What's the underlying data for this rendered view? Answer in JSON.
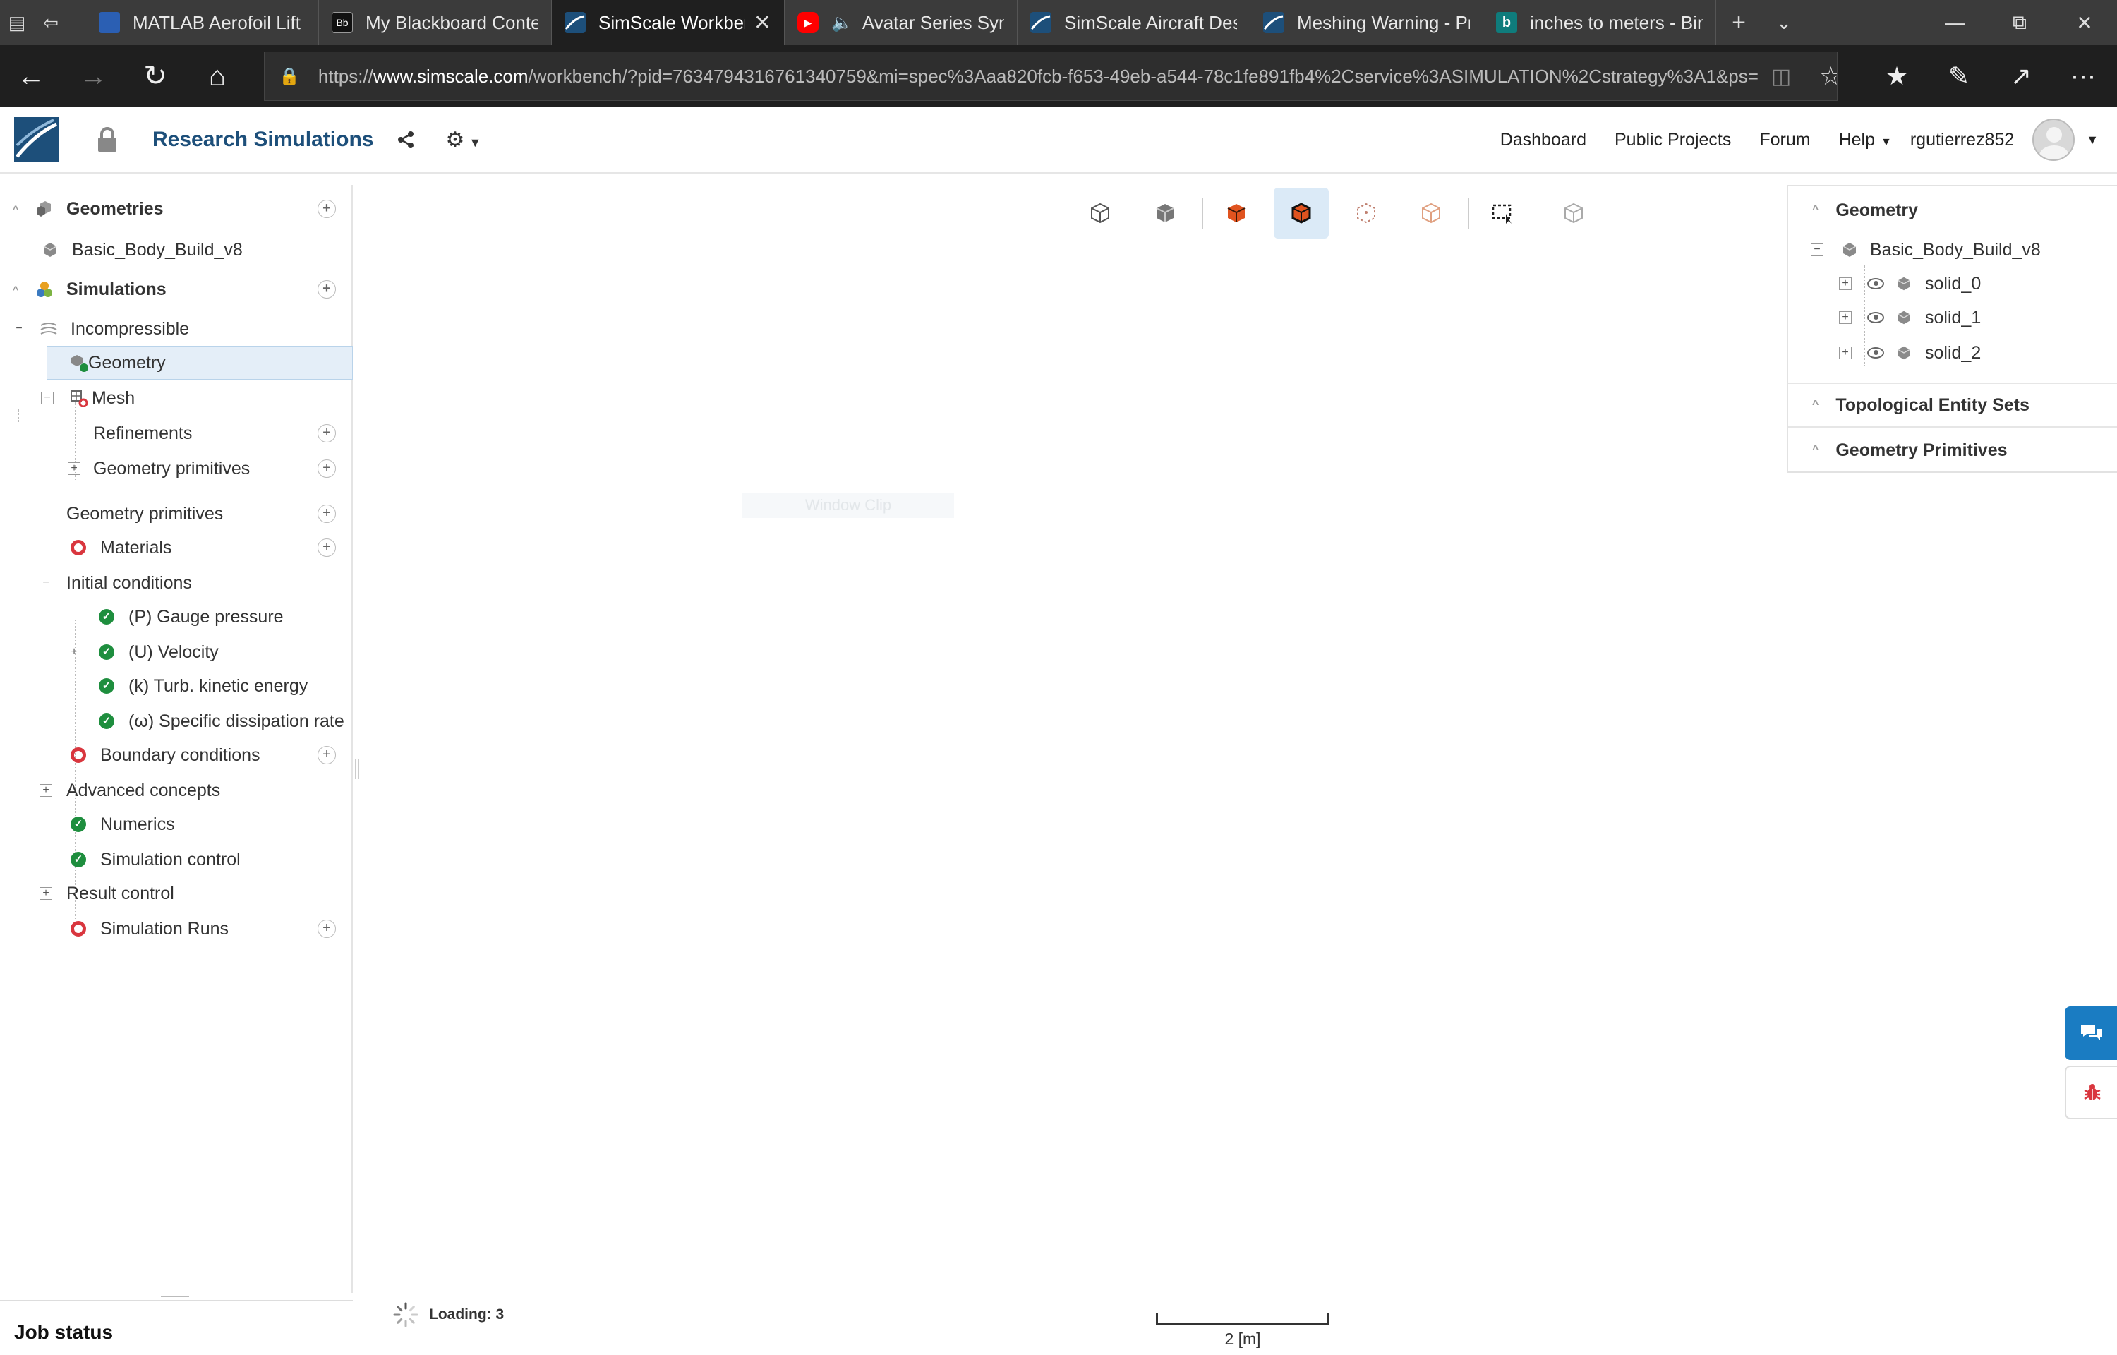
{
  "browser": {
    "tabs": [
      {
        "title": "MATLAB Aerofoil Lift C",
        "fav_color": "#2b5fb3",
        "icon": "matlab-tab-favicon"
      },
      {
        "title": "My Blackboard Conter",
        "fav_color": "#111111",
        "icon": "blackboard-tab-favicon"
      },
      {
        "title": "SimScale Workber",
        "fav_color": "#1d4f7a",
        "icon": "simscale-tab-favicon",
        "active": true
      },
      {
        "title": "Avatar Series Sym",
        "fav_color": "#ff0000",
        "icon": "youtube-tab-favicon"
      },
      {
        "title": "SimScale Aircraft Desi",
        "fav_color": "#1d4f7a",
        "icon": "simscale-tab-favicon"
      },
      {
        "title": "Meshing Warning - Pr",
        "fav_color": "#1d4f7a",
        "icon": "simscale-tab-favicon"
      },
      {
        "title": "inches to meters - Bin",
        "fav_color": "#0f7c7c",
        "icon": "bing-tab-favicon"
      }
    ],
    "url_prefix": "https://",
    "url_host": "www.simscale.com",
    "url_tail": "/workbench/?pid=7634794316761340759&mi=spec%3Aaa820fcb-f653-49eb-a544-78c1fe891fb4%2Cservice%3ASIMULATION%2Cstrategy%3A1&ps="
  },
  "header": {
    "project_title": "Research Simulations",
    "nav": {
      "dashboard": "Dashboard",
      "public_projects": "Public Projects",
      "forum": "Forum",
      "help": "Help",
      "username": "rgutierrez852"
    }
  },
  "tree": {
    "geometries": "Geometries",
    "geometry_item": "Basic_Body_Build_v8",
    "simulations": "Simulations",
    "incompressible": "Incompressible",
    "geometry": "Geometry",
    "mesh": "Mesh",
    "refinements": "Refinements",
    "mesh_geometry_primitives": "Geometry primitives",
    "geometry_primitives": "Geometry primitives",
    "materials": "Materials",
    "initial_conditions": "Initial conditions",
    "ic_pressure": "(P) Gauge pressure",
    "ic_velocity": "(U) Velocity",
    "ic_k": "(k) Turb. kinetic energy",
    "ic_omega": "(ω) Specific dissipation rate",
    "boundary_conditions": "Boundary conditions",
    "advanced_concepts": "Advanced concepts",
    "numerics": "Numerics",
    "simulation_control": "Simulation control",
    "result_control": "Result control",
    "simulation_runs": "Simulation Runs"
  },
  "job_status": "Job status",
  "right_panel": {
    "geometry_header": "Geometry",
    "body": "Basic_Body_Build_v8",
    "solids": [
      "solid_0",
      "solid_1",
      "solid_2"
    ],
    "topological_entity_sets": "Topological Entity Sets",
    "geometry_primitives": "Geometry Primitives"
  },
  "viewport": {
    "watermark": "Window Clip",
    "loading": "Loading: 3",
    "scale_label": "2 [m]"
  },
  "colors": {
    "accent": "#1d4f7a",
    "ok": "#1e8e3e",
    "error": "#d9363e",
    "selected": "#e4eef8"
  }
}
